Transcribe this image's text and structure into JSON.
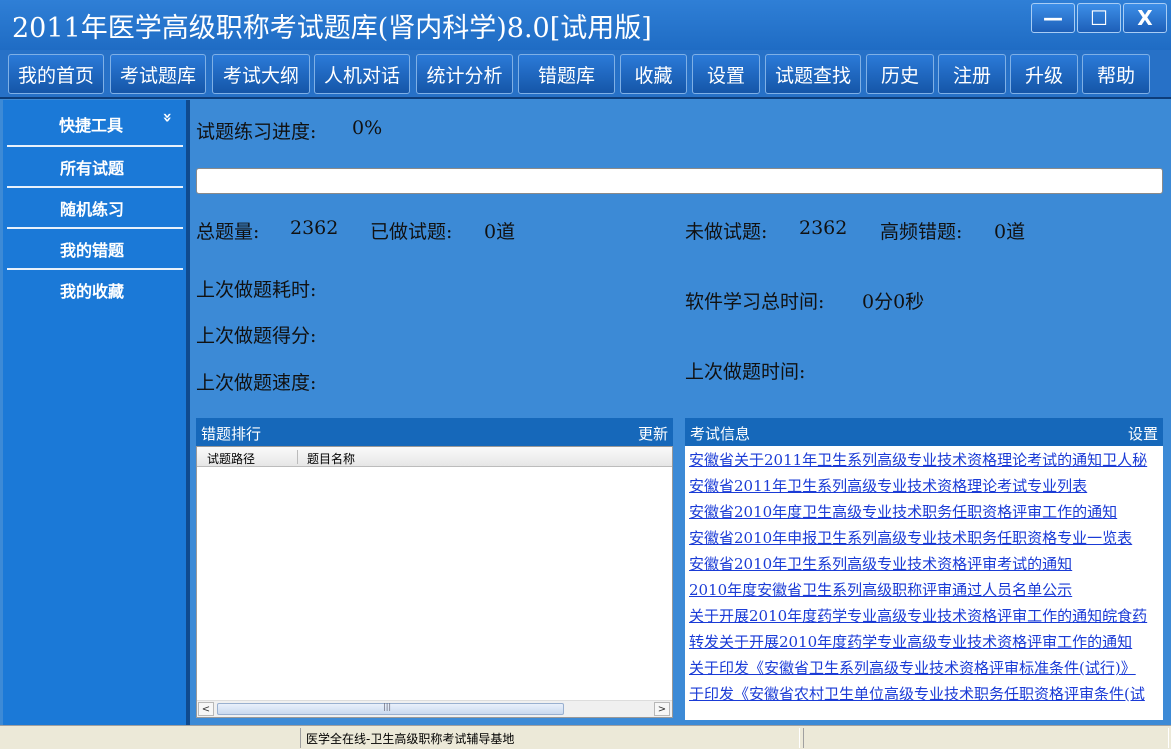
{
  "window": {
    "title": "2011年医学高级职称考试题库(肾内科学)8.0[试用版]",
    "minimize_glyph": "—",
    "maximize_glyph": "☐",
    "close_glyph": "X"
  },
  "nav": {
    "items": [
      "我的首页",
      "考试题库",
      "考试大纲",
      "人机对话",
      "统计分析",
      "错题库",
      "收藏",
      "设置",
      "试题查找",
      "历史",
      "注册",
      "升级",
      "帮助"
    ]
  },
  "sidebar": {
    "header": "快捷工具",
    "chevron": "»",
    "items": [
      "所有试题",
      "随机练习",
      "我的错题",
      "我的收藏"
    ]
  },
  "stats": {
    "progress_label": "试题练习进度:",
    "progress_value": "0%",
    "progress_fraction": 0,
    "total_label": "总题量:",
    "total_value": "2362",
    "done_label": "已做试题:",
    "done_value": "0道",
    "undone_label": "未做试题:",
    "undone_value": "2362",
    "freq_wrong_label": "高频错题:",
    "freq_wrong_value": "0道",
    "last_time_cost_label": "上次做题耗时:",
    "last_score_label": "上次做题得分:",
    "last_speed_label": "上次做题速度:",
    "study_total_label": "软件学习总时间:",
    "study_total_value": "0分0秒",
    "last_date_label": "上次做题时间:"
  },
  "error_rank": {
    "title": "错题排行",
    "refresh": "更新",
    "columns": [
      "试题路径",
      "题目名称"
    ],
    "scroll_left": "<",
    "scroll_right": ">",
    "scroll_grip": "|||"
  },
  "exam_info": {
    "title": "考试信息",
    "settings": "设置",
    "links": [
      "安徽省关于2011年卫生系列高级专业技术资格理论考试的通知卫人秘",
      "安徽省2011年卫生系列高级专业技术资格理论考试专业列表",
      "安徽省2010年度卫生高级专业技术职务任职资格评审工作的通知",
      "安徽省2010年申报卫生系列高级专业技术职务任职资格专业一览表",
      "安徽省2010年卫生系列高级专业技术资格评审考试的通知",
      "2010年度安徽省卫生系列高级职称评审通过人员名单公示",
      "关于开展2010年度药学专业高级专业技术资格评审工作的通知皖食药",
      "转发关于开展2010年度药学专业高级专业技术资格评审工作的通知",
      "关于印发《安徽省卫生系列高级专业技术资格评审标准条件(试行)》",
      "于印发《安徽省农村卫生单位高级专业技术职务任职资格评审条件(试"
    ]
  },
  "statusbar": {
    "text": "医学全在线-卫生高级职称考试辅导基地"
  }
}
